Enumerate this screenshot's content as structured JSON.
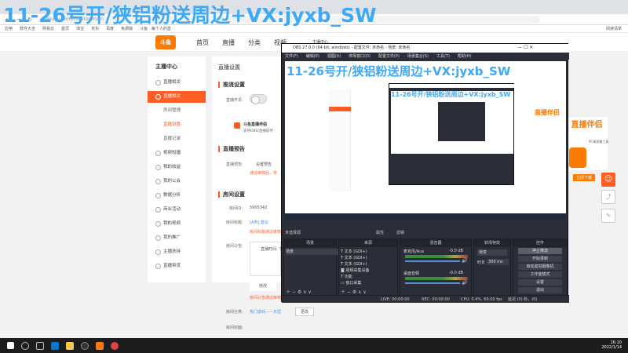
{
  "browser": {
    "url": "douyu.com/creator/main",
    "bookmarks": [
      "应用",
      "软件大全",
      "网易云",
      "首页",
      "淘宝",
      "京东",
      "百度",
      "免费版",
      "斗鱼 · 每个人的直",
      "阅读清单"
    ]
  },
  "topnav": {
    "logo": "斗鱼",
    "items": [
      "首页",
      "直播",
      "分类",
      "视频"
    ],
    "login": "主播中心"
  },
  "watermark": "11-26号开/狭铝粉送周边+VX:jyxb_SW",
  "sidebar": {
    "title": "主播中心",
    "items": [
      {
        "label": "直播相关"
      },
      {
        "label": "直播相关",
        "active": true
      },
      {
        "label": "房间管理",
        "sub": true
      },
      {
        "label": "直播设置",
        "sub": true,
        "selected": true
      },
      {
        "label": "直播记录",
        "sub": true
      },
      {
        "label": "视频短播"
      },
      {
        "label": "我的收益"
      },
      {
        "label": "我的公会"
      },
      {
        "label": "数据分析"
      },
      {
        "label": "商业活动"
      },
      {
        "label": "我的视频"
      },
      {
        "label": "我的推广"
      },
      {
        "label": "主播扶持"
      },
      {
        "label": "直播带货"
      }
    ]
  },
  "main": {
    "header": "直播设置",
    "sections": {
      "push": "推流设置",
      "push_label": "直播开关:",
      "assistant_title": "斗鱼直播伴侣",
      "assistant_desc": "支持OBS/直播软件",
      "preview": "直播预告",
      "preview_label": "直播预告:",
      "preview_btn": "设置预告",
      "preview_note": "通过审核后，将",
      "room": "房间设置",
      "room_id_label": "房间ID:",
      "room_id": "5905342",
      "room_title_label": "房间标题:",
      "room_title_link": "[A类] 建议",
      "room_title_note": "房间标题通过审核",
      "notice_label": "房间公告:",
      "notice_time": "直播时间: 下",
      "edit_btn": "修改",
      "notice_note": "房间公告通过审核",
      "category_label": "房间分类:",
      "category": "热门游戏——天涯",
      "category_btn": "更改",
      "cover_label": "房间封面:"
    }
  },
  "promo": {
    "title": "直播伴侣",
    "sub": "PC端直播工具",
    "btn": "立即下载"
  },
  "obs": {
    "title": "OBS 27.0.0 (64-bit, windows) - 配置文件: 未命名 - 场景: 未命名",
    "menu": [
      "文件(F)",
      "编辑(E)",
      "视图(V)",
      "停靠窗口(D)",
      "配置文件(P)",
      "场景集合(S)",
      "工具(T)",
      "帮助(H)"
    ],
    "no_source": "未选择源",
    "properties": "属性",
    "filters": "滤镜",
    "docks": {
      "scenes": "场景",
      "sources": "来源",
      "mixer": "混音器",
      "transitions": "转场特效",
      "controls": "控件"
    },
    "scene_item": "场景",
    "sources": [
      "文本 (GDI+)",
      "文本 (GDI+)",
      "文本 (GDI+)",
      "视频采集设备",
      "功能",
      "窗口采集"
    ],
    "mixer": [
      {
        "name": "麦克风/Aux",
        "db": "-0.0 dB"
      },
      {
        "name": "桌面音频",
        "db": "-0.0 dB"
      }
    ],
    "transition": {
      "type": "渐变",
      "duration_label": "时长",
      "duration": "300 ms"
    },
    "controls": [
      "停止推流",
      "开始录制",
      "启动虚拟摄像机",
      "工作室模式",
      "设置",
      "退出"
    ],
    "status": {
      "live": "LIVE: 00:00:00",
      "rec": "REC: 00:00:00",
      "cpu": "CPU: 0.4%, 60.00 fps",
      "delay": "延迟 (0) 秒，(0)"
    }
  },
  "taskbar": {
    "time": "16:10",
    "date": "2022/1/14"
  }
}
